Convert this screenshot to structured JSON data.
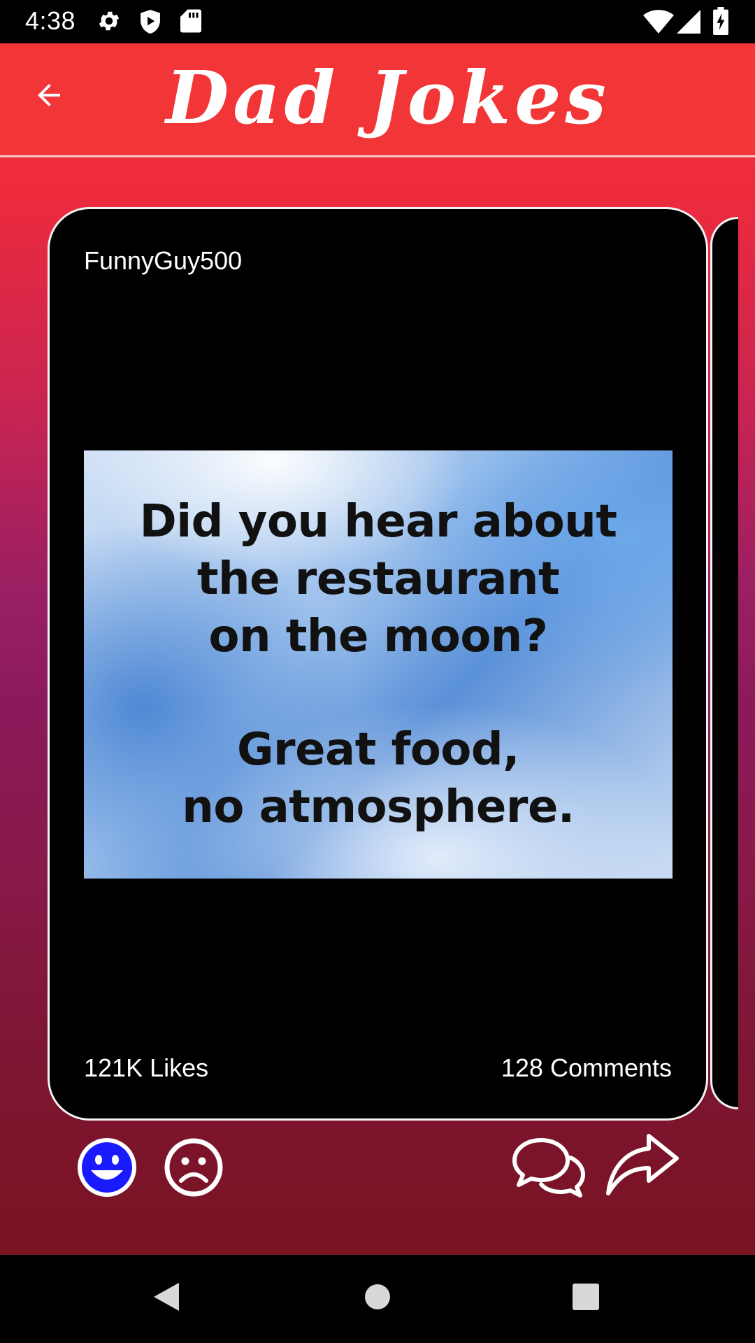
{
  "status_bar": {
    "time": "4:38",
    "icons": [
      "gear-icon",
      "shield-play-icon",
      "sd-card-icon",
      "wifi-icon",
      "cell-signal-icon",
      "battery-charging-icon"
    ]
  },
  "header": {
    "title": "Dad Jokes",
    "back_icon": "arrow-left-icon",
    "color": "#f23536"
  },
  "card": {
    "username": "FunnyGuy500",
    "joke_image": {
      "setup_lines": [
        "Did you hear about",
        "the restaurant",
        "on the moon?"
      ],
      "punchline_lines": [
        "Great food,",
        "no atmosphere."
      ]
    },
    "likes": "121K Likes",
    "comments": "128 Comments"
  },
  "actions": {
    "like_icon": "smiley-happy-icon",
    "like_color": "#1a1aff",
    "dislike_icon": "smiley-sad-icon",
    "comment_icon": "chat-bubbles-icon",
    "share_icon": "share-arrow-icon"
  },
  "nav_bar": {
    "icons": [
      "back-triangle-icon",
      "home-circle-icon",
      "recents-square-icon"
    ]
  }
}
